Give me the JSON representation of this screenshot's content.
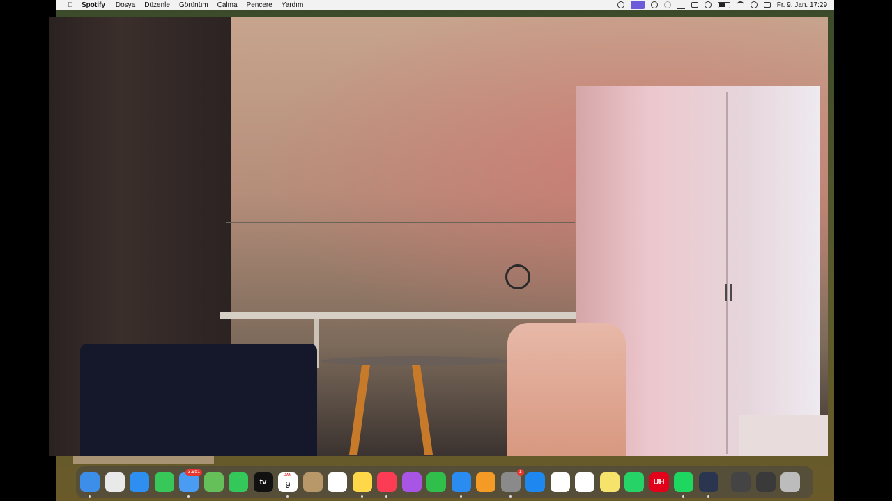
{
  "menubar": {
    "apple_icon": "apple-icon",
    "app_name": "Spotify",
    "menus": [
      "Dosya",
      "Düzenle",
      "Görünüm",
      "Çalma",
      "Pencere",
      "Yardım"
    ],
    "status_icons": [
      "focus-icon",
      "screen-share-icon",
      "creative-cloud-icon",
      "shazam-icon",
      "vpn-icon",
      "window-icon",
      "play-icon",
      "battery-icon",
      "wifi-icon",
      "search-icon",
      "control-center-icon"
    ],
    "clock": "Fr. 9. Jan.  17:29"
  },
  "dock": {
    "apps": [
      {
        "name": "Finder",
        "color": "#3d8ee8"
      },
      {
        "name": "Launchpad",
        "color": "#e9e9e9"
      },
      {
        "name": "Safari",
        "color": "#2f8ff0"
      },
      {
        "name": "Messages",
        "color": "#38c759"
      },
      {
        "name": "Mail",
        "color": "#4a9cf3",
        "badge": "3.951"
      },
      {
        "name": "Maps",
        "color": "#66c05a"
      },
      {
        "name": "FaceTime",
        "color": "#34c759"
      },
      {
        "name": "Apple TV",
        "color": "#111111",
        "glyph": "tv"
      },
      {
        "name": "Calendar",
        "color": "#ffffff",
        "month": "JAN",
        "day": "9"
      },
      {
        "name": "Contacts",
        "color": "#b89768"
      },
      {
        "name": "Reminders",
        "color": "#ffffff"
      },
      {
        "name": "Notes",
        "color": "#ffd84a"
      },
      {
        "name": "Music",
        "color": "#fc3c54"
      },
      {
        "name": "Podcasts",
        "color": "#a855e6"
      },
      {
        "name": "Numbers",
        "color": "#2fbf4a"
      },
      {
        "name": "Keynote",
        "color": "#2a8cf0"
      },
      {
        "name": "Pages",
        "color": "#f39b24"
      },
      {
        "name": "System Settings",
        "color": "#8a8a8a",
        "badge": "1"
      },
      {
        "name": "App Store",
        "color": "#1e88f0"
      },
      {
        "name": "Chrome",
        "color": "#ffffff"
      },
      {
        "name": "ChatGPT",
        "color": "#ffffff"
      },
      {
        "name": "Stickies",
        "color": "#f5e36b"
      },
      {
        "name": "WhatsApp",
        "color": "#25d366"
      },
      {
        "name": "UHH",
        "color": "#e2001a",
        "glyph": "UH"
      },
      {
        "name": "Spotify",
        "color": "#1ed760"
      },
      {
        "name": "Screen Recorder",
        "color": "#2a3550"
      }
    ],
    "recents": [
      {
        "name": "Photo Booth",
        "color": "#444444"
      },
      {
        "name": "Preview",
        "color": "#3a3a3a"
      },
      {
        "name": "Trash",
        "color": "#bcbcbc"
      }
    ]
  }
}
